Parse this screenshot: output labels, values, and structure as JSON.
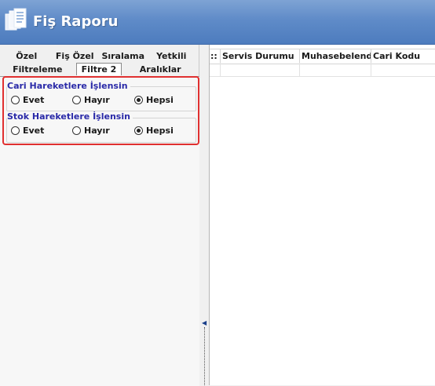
{
  "window": {
    "title": "Fiş Raporu",
    "icon": "report-pages-icon",
    "titlebar_color": "#5f8bc8"
  },
  "tabs": {
    "row1": [
      {
        "label": "Özel"
      },
      {
        "label": "Fiş Özel"
      },
      {
        "label": "Sıralama"
      },
      {
        "label": "Yetkili"
      }
    ],
    "row2": [
      {
        "label": "Filtreleme"
      },
      {
        "label": "Filtre 2",
        "active": true
      },
      {
        "label": "Aralıklar"
      }
    ]
  },
  "filters": {
    "cari": {
      "title": "Cari Hareketlere İşlensin",
      "options": [
        "Evet",
        "Hayır",
        "Hepsi"
      ],
      "selected": "Hepsi"
    },
    "stok": {
      "title": "Stok Hareketlere İşlensin",
      "options": [
        "Evet",
        "Hayır",
        "Hepsi"
      ],
      "selected": "Hepsi"
    }
  },
  "highlight_color": "#e03030",
  "grid": {
    "indicator": "::",
    "columns": [
      "Servis Durumu",
      "Muhasebelendi",
      "Cari Kodu"
    ]
  }
}
